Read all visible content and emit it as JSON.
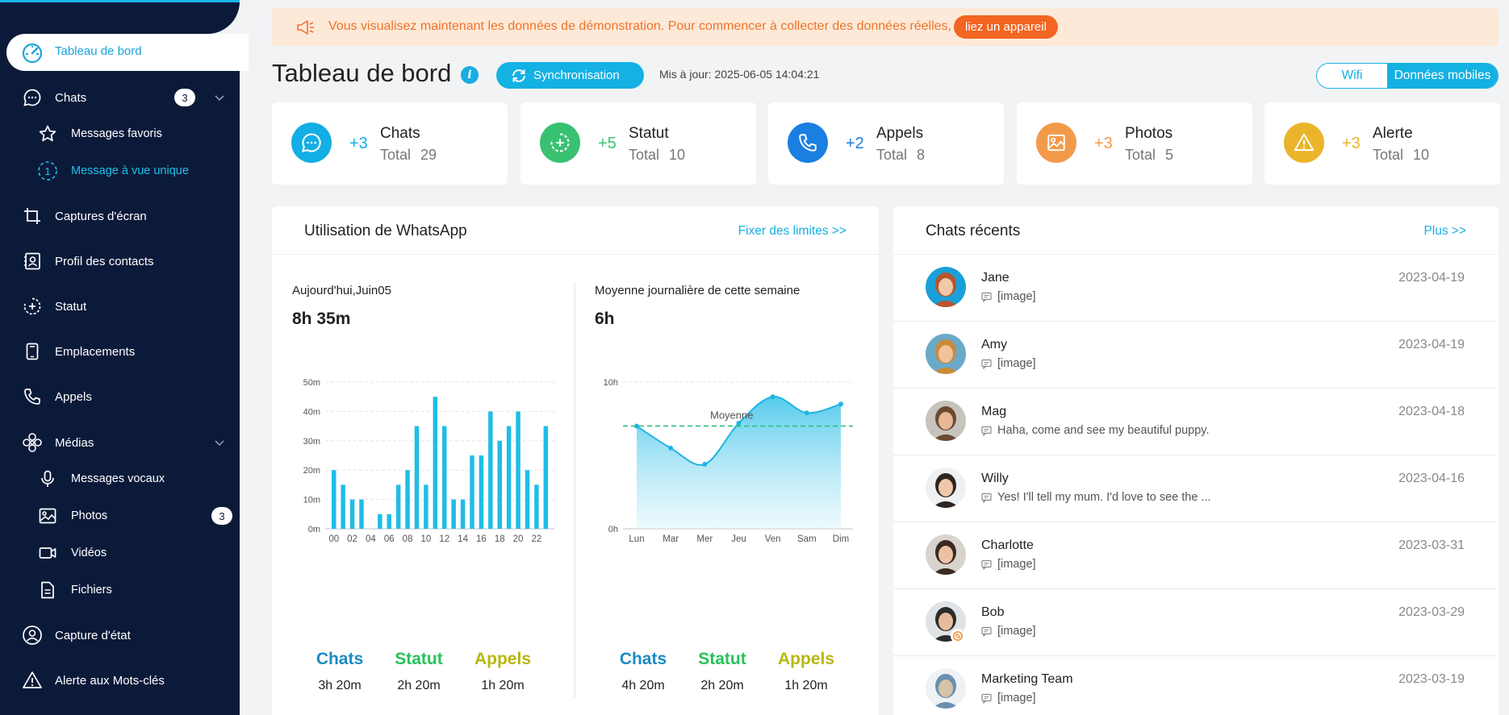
{
  "sidebar": {
    "active": "Tableau de bord",
    "items": [
      {
        "label": "Chats",
        "badge": "3"
      },
      {
        "label": "Messages favoris"
      },
      {
        "label": "Message à vue unique"
      },
      {
        "label": "Captures d'écran"
      },
      {
        "label": "Profil des contacts"
      },
      {
        "label": "Statut"
      },
      {
        "label": "Emplacements"
      },
      {
        "label": "Appels"
      },
      {
        "label": "Médias"
      },
      {
        "label": "Messages vocaux"
      },
      {
        "label": "Photos",
        "badge": "3"
      },
      {
        "label": "Vidéos"
      },
      {
        "label": "Fichiers"
      },
      {
        "label": "Capture d'état"
      },
      {
        "label": "Alerte aux Mots-clés"
      }
    ]
  },
  "banner": {
    "text": "Vous visualisez maintenant les données de démonstration. Pour commencer à collecter des données réelles,",
    "button": "liez un appareil"
  },
  "header": {
    "title": "Tableau de bord",
    "sync": "Synchronisation",
    "updated": "Mis à jour: 2025-06-05 14:04:21",
    "toggle": [
      "Wifi",
      "Données mobiles"
    ]
  },
  "stats": [
    {
      "plus": "+3",
      "name": "Chats",
      "total_label": "Total",
      "total": "29",
      "color": "#12aee4"
    },
    {
      "plus": "+5",
      "name": "Statut",
      "total_label": "Total",
      "total": "10",
      "color": "#39c172"
    },
    {
      "plus": "+2",
      "name": "Appels",
      "total_label": "Total",
      "total": "8",
      "color": "#1b7fe2"
    },
    {
      "plus": "+3",
      "name": "Photos",
      "total_label": "Total",
      "total": "5",
      "color": "#f39a4a"
    },
    {
      "plus": "+3",
      "name": "Alerte",
      "total_label": "Total",
      "total": "10",
      "color": "#eab52a"
    }
  ],
  "usage": {
    "title": "Utilisation de WhatsApp",
    "link": "Fixer des limites >>",
    "today_label": "Aujourd'hui,Juin05",
    "today_value": "8h 35m",
    "week_label": "Moyenne journalière de cette semaine",
    "week_value": "6h",
    "today_legend": [
      {
        "name": "Chats",
        "value": "3h 20m",
        "color": "#1b8bc4"
      },
      {
        "name": "Statut",
        "value": "2h 20m",
        "color": "#27c25a"
      },
      {
        "name": "Appels",
        "value": "1h 20m",
        "color": "#b8b70f"
      }
    ],
    "week_legend": [
      {
        "name": "Chats",
        "value": "4h 20m",
        "color": "#1b8bc4"
      },
      {
        "name": "Statut",
        "value": "2h 20m",
        "color": "#27c25a"
      },
      {
        "name": "Appels",
        "value": "1h 20m",
        "color": "#b8b70f"
      }
    ]
  },
  "chart_data": [
    {
      "type": "bar",
      "yticks": [
        "0m",
        "10m",
        "20m",
        "30m",
        "40m",
        "50m"
      ],
      "ylim": [
        0,
        50
      ],
      "xticks": [
        "00",
        "02",
        "04",
        "06",
        "08",
        "10",
        "12",
        "14",
        "16",
        "18",
        "20",
        "22"
      ],
      "categories": [
        "00",
        "01",
        "02",
        "03",
        "04",
        "05",
        "06",
        "07",
        "08",
        "09",
        "10",
        "11",
        "12",
        "13",
        "14",
        "15",
        "16",
        "17",
        "18",
        "19",
        "20",
        "21",
        "22",
        "23"
      ],
      "values": [
        20,
        15,
        10,
        10,
        0,
        5,
        5,
        15,
        20,
        35,
        15,
        45,
        35,
        10,
        10,
        25,
        25,
        40,
        30,
        35,
        40,
        20,
        15,
        35
      ],
      "color": "#1fbde6",
      "grid": true
    },
    {
      "type": "area",
      "yticks": [
        "0h",
        "10h"
      ],
      "ylim": [
        0,
        10
      ],
      "categories": [
        "Lun",
        "Mar",
        "Mer",
        "Jeu",
        "Ven",
        "Sam",
        "Dim"
      ],
      "values": [
        7,
        5.5,
        4.4,
        7.2,
        9,
        7.9,
        8.5
      ],
      "average": {
        "label": "Moyenne",
        "value": 7
      }
    }
  ],
  "recent": {
    "title": "Chats récents",
    "link": "Plus >>",
    "items": [
      {
        "name": "Jane",
        "msg": "[image]",
        "date": "2023-04-19"
      },
      {
        "name": "Amy",
        "msg": "[image]",
        "date": "2023-04-19"
      },
      {
        "name": "Mag",
        "msg": "Haha, come and see my beautiful puppy.",
        "date": "2023-04-18"
      },
      {
        "name": "Willy",
        "msg": "Yes! I'll tell my mum. I'd love to see the ...",
        "date": "2023-04-16"
      },
      {
        "name": "Charlotte",
        "msg": "[image]",
        "date": "2023-03-31"
      },
      {
        "name": "Bob",
        "msg": "[image]",
        "date": "2023-03-29"
      },
      {
        "name": "Marketing Team",
        "msg": "[image]",
        "date": "2023-03-19"
      }
    ]
  }
}
